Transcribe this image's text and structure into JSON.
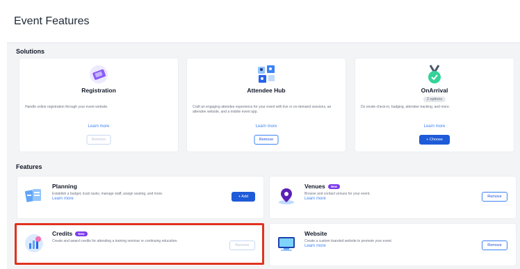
{
  "page": {
    "title": "Event Features"
  },
  "solutions": {
    "label": "Solutions",
    "cards": [
      {
        "icon": "ticket-icon",
        "title": "Registration",
        "badge": "",
        "desc": "Handle online registration through your event website.",
        "learn": "Learn more",
        "button": "Remove",
        "button_kind": "remove-disabled"
      },
      {
        "icon": "people-grid-icon",
        "title": "Attendee Hub",
        "badge": "",
        "desc": "Craft an engaging attendee experience for your event with live or on-demand sessions, an attendee website, and a mobile event app.",
        "learn": "Learn more",
        "button": "Remove",
        "button_kind": "remove"
      },
      {
        "icon": "badge-check-icon",
        "title": "OnArrival",
        "badge": "2 options",
        "desc": "Do onsite check-in, badging, attendee tracking, and more.",
        "learn": "Learn more",
        "button": "+ Choose",
        "button_kind": "primary"
      }
    ]
  },
  "features": {
    "label": "Features",
    "cards": [
      {
        "icon": "planning-icon",
        "title": "Planning",
        "badge": "",
        "desc": "Establish a budget, track tasks, manage staff, assign seating, and more.",
        "learn": "Learn more",
        "button": "+ Add",
        "button_kind": "primary"
      },
      {
        "icon": "location-pin-icon",
        "title": "Venues",
        "badge": "New",
        "desc": "Browse and contact venues for your event.",
        "learn": "Learn more",
        "button": "Remove",
        "button_kind": "remove"
      },
      {
        "icon": "credits-chart-icon",
        "title": "Credits",
        "badge": "New",
        "desc": "Create and award credits for attending a training seminar or continuing education.",
        "learn": "",
        "button": "Remove",
        "button_kind": "remove-disabled"
      },
      {
        "icon": "website-monitor-icon",
        "title": "Website",
        "badge": "",
        "desc": "Create a custom branded website to promote your event.",
        "learn": "Learn more",
        "button": "Remove",
        "button_kind": "remove"
      }
    ]
  },
  "colors": {
    "primary": "#1e5bd8",
    "link": "#3b82f6",
    "badge_new": "#7c3aed",
    "highlight": "#e0321e",
    "panel": "#f3f4f6"
  }
}
